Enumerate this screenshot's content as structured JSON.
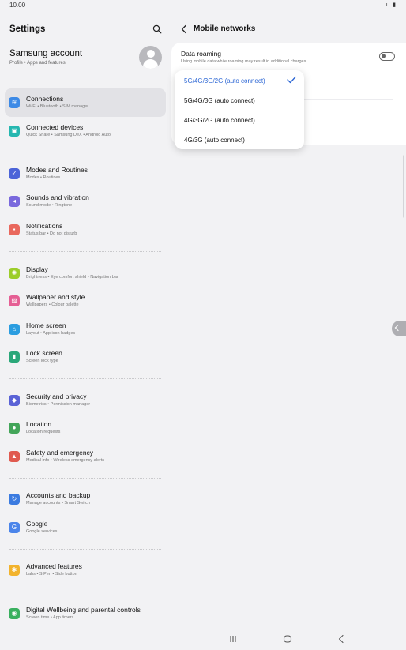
{
  "status_bar": {
    "time": "10.00",
    "icons": ".ıl ▮"
  },
  "left": {
    "title": "Settings",
    "account": {
      "title": "Samsung account",
      "subtitle": "Profile • Apps and features"
    },
    "items": [
      {
        "title": "Connections",
        "subtitle": "Wi-Fi • Bluetooth • SIM manager",
        "icon": "wifi-icon",
        "color": "#3d8ae6",
        "glyph": "≋"
      },
      {
        "title": "Connected devices",
        "subtitle": "Quick Share • Samsung DeX • Android Auto",
        "icon": "connected-devices-icon",
        "color": "#25b7b0",
        "glyph": "▣"
      },
      {
        "title": "Modes and Routines",
        "subtitle": "Modes • Routines",
        "icon": "modes-icon",
        "color": "#4c64d8",
        "glyph": "✓"
      },
      {
        "title": "Sounds and vibration",
        "subtitle": "Sound mode • Ringtone",
        "icon": "sound-icon",
        "color": "#7a69dd",
        "glyph": "◂"
      },
      {
        "title": "Notifications",
        "subtitle": "Status bar • Do not disturb",
        "icon": "notifications-icon",
        "color": "#e9685d",
        "glyph": "▪"
      },
      {
        "title": "Display",
        "subtitle": "Brightness • Eye comfort shield • Navigation bar",
        "icon": "display-icon",
        "color": "#9ccd2a",
        "glyph": "✺"
      },
      {
        "title": "Wallpaper and style",
        "subtitle": "Wallpapers • Colour palette",
        "icon": "wallpaper-icon",
        "color": "#e55f94",
        "glyph": "▨"
      },
      {
        "title": "Home screen",
        "subtitle": "Layout • App icon badges",
        "icon": "home-icon",
        "color": "#2b9de0",
        "glyph": "⌂"
      },
      {
        "title": "Lock screen",
        "subtitle": "Screen lock type",
        "icon": "lock-icon",
        "color": "#2aa779",
        "glyph": "▮"
      },
      {
        "title": "Security and privacy",
        "subtitle": "Biometrics • Permission manager",
        "icon": "shield-icon",
        "color": "#5a63d6",
        "glyph": "◆"
      },
      {
        "title": "Location",
        "subtitle": "Location requests",
        "icon": "location-icon",
        "color": "#43a559",
        "glyph": "●"
      },
      {
        "title": "Safety and emergency",
        "subtitle": "Medical info • Wireless emergency alerts",
        "icon": "emergency-icon",
        "color": "#e05a4f",
        "glyph": "▲"
      },
      {
        "title": "Accounts and backup",
        "subtitle": "Manage accounts • Smart Switch",
        "icon": "accounts-icon",
        "color": "#3b7be0",
        "glyph": "↻"
      },
      {
        "title": "Google",
        "subtitle": "Google services",
        "icon": "google-icon",
        "color": "#4b85ea",
        "glyph": "G"
      },
      {
        "title": "Advanced features",
        "subtitle": "Labs • S Pen • Side button",
        "icon": "advanced-icon",
        "color": "#f2b32d",
        "glyph": "✱"
      },
      {
        "title": "Digital Wellbeing and parental controls",
        "subtitle": "Screen time • App timers",
        "icon": "wellbeing-icon",
        "color": "#3ab05f",
        "glyph": "◉"
      }
    ]
  },
  "right": {
    "title": "Mobile networks",
    "data_roaming": {
      "title": "Data roaming",
      "subtitle": "Using mobile data while roaming may result in additional charges.",
      "enabled": false
    },
    "network_mode": {
      "selected": "5G/4G/3G/2G (auto connect)",
      "options": [
        "5G/4G/3G/2G (auto connect)",
        "5G/4G/3G (auto connect)",
        "4G/3G/2G (auto connect)",
        "4G/3G (auto connect)"
      ]
    }
  },
  "colors": {
    "accent": "#2a65d4",
    "selected_row": "#e2e2e6",
    "background": "#f2f2f4"
  }
}
